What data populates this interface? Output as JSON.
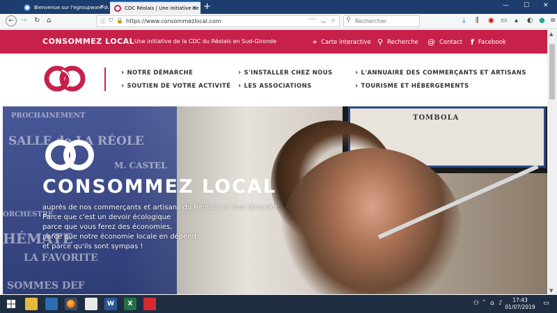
{
  "browser": {
    "tabs": [
      {
        "label": "Bienvenue sur l'egroupware du",
        "active": false
      },
      {
        "label": "CDC Réolais | Une initiative de",
        "active": true
      }
    ],
    "url": "https://www.consommezlocal.com",
    "search_placeholder": "Rechercher",
    "new_tab_icon": "plus-icon"
  },
  "site": {
    "brand": "CONSOMMEZ LOCAL",
    "tagline": "Une initiative de la CDC du Réolais en Sud-Gironde",
    "top_links": [
      {
        "label": "Carte interactive",
        "icon": "map-pin-icon"
      },
      {
        "label": "Recherche",
        "icon": "search-icon"
      },
      {
        "label": "Contact",
        "icon": "at-icon"
      },
      {
        "label": "Facebook",
        "icon": "facebook-icon"
      }
    ],
    "menu": [
      "NOTRE DÉMARCHE",
      "SOUTIEN DE VOTRE ACTIVITÉ",
      "S'INSTALLER CHEZ NOUS",
      "LES ASSOCIATIONS",
      "L'ANNUAIRE DES COMMERÇANTS ET ARTISANS",
      "TOURISME ET HÉBERGEMENTS"
    ],
    "colors": {
      "brand_red": "#c7214a"
    }
  },
  "hero": {
    "title": "CONSOMMEZ LOCAL",
    "lines": [
      "auprès de nos commerçants et artisans du Réolais en Sud Gironde!",
      "Parce que c'est un devoir écologique",
      "parce que vous ferez des économies,",
      "parce que notre économie locale en dépend",
      "et parce qu'ils sont sympas !"
    ],
    "poster_text": [
      "PROCHAINEMENT",
      "SALLE de LA RÉOLE",
      "M. CASTEL",
      "ORCHESTRE",
      "HÉMATE",
      "LA FAVORITE",
      "SOMMES DEF"
    ],
    "frame_text": "TOMBOLA"
  },
  "taskbar": {
    "time": "17:43",
    "date": "01/07/2019"
  }
}
